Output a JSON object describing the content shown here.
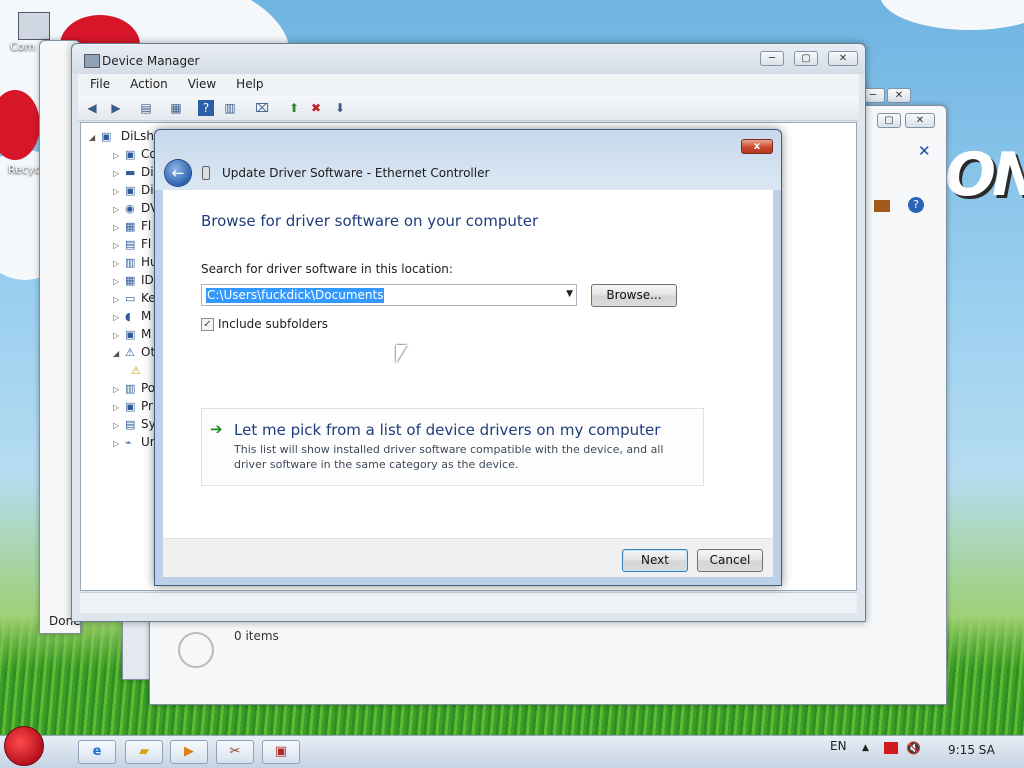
{
  "desktop": {
    "icon_computer_label": "Com",
    "icon_recycle_label": "Recyc",
    "wallpaper_text": "ON"
  },
  "device_manager": {
    "title": "Device Manager",
    "menu": [
      "File",
      "Action",
      "View",
      "Help"
    ],
    "tree_root": "DiLsh",
    "tree_items": [
      "Co",
      "Di",
      "Di",
      "DV",
      "Fl",
      "Fl",
      "Hu",
      "ID",
      "Ke",
      "M",
      "M",
      "Ot",
      "",
      "Po",
      "Pr",
      "Sy",
      "Ur"
    ],
    "status": "Done"
  },
  "back_window": {
    "items_count": "0 items"
  },
  "dialog": {
    "title": "Update Driver Software - Ethernet Controller",
    "heading": "Browse for driver software on your computer",
    "search_label": "Search for driver software in this location:",
    "path_value": "C:\\Users\\fuckdick\\Documents",
    "browse_label": "Browse...",
    "include_subfolders_label": "Include subfolders",
    "include_subfolders_checked": true,
    "pick_title": "Let me pick from a list of device drivers on my computer",
    "pick_desc": "This list will show installed driver software compatible with the device, and all driver software in the same category as the device.",
    "next_label": "Next",
    "cancel_label": "Cancel",
    "close_glyph": "x"
  },
  "taskbar": {
    "language": "EN",
    "clock": "9:15 SA"
  }
}
